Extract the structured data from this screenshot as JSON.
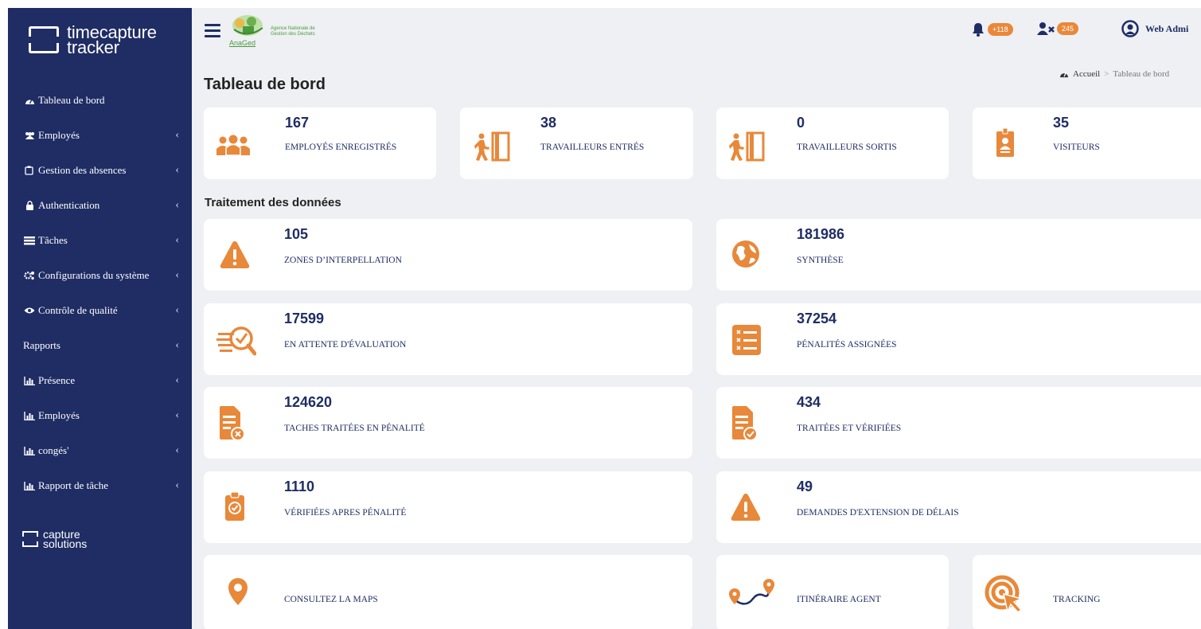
{
  "brand": {
    "line1": "timecapture",
    "line2": "tracker"
  },
  "footer_brand": {
    "line1": "capture",
    "line2": "solutions"
  },
  "sidebar": {
    "items": [
      {
        "label": "Tableau de bord",
        "icon": "tachometer-icon",
        "chevron": false
      },
      {
        "label": "Employés",
        "icon": "users-icon",
        "chevron": true
      },
      {
        "label": "Gestion des absences",
        "icon": "clipboard-icon",
        "chevron": true
      },
      {
        "label": "Authentication",
        "icon": "lock-icon",
        "chevron": true
      },
      {
        "label": "Tâches",
        "icon": "tasks-icon",
        "chevron": true
      },
      {
        "label": "Configurations du système",
        "icon": "gears-icon",
        "chevron": true
      },
      {
        "label": "Contrôle de qualité",
        "icon": "eye-icon",
        "chevron": true
      },
      {
        "label": "Rapports",
        "icon": "",
        "chevron": true
      },
      {
        "label": "Présence",
        "icon": "bar-chart-icon",
        "chevron": true
      },
      {
        "label": "Employés",
        "icon": "bar-chart-icon",
        "chevron": true
      },
      {
        "label": "congés'",
        "icon": "bar-chart-icon",
        "chevron": true
      },
      {
        "label": "Rapport de tâche",
        "icon": "bar-chart-icon",
        "chevron": true
      }
    ]
  },
  "header": {
    "org_name_line1": "Agence Nationale de",
    "org_name_line2": "Gestion des Déchets",
    "org_abbr": "AnaGed",
    "notifications_count": "+118",
    "absent_count": "245",
    "user_name": "Web Admi"
  },
  "breadcrumb": {
    "home": "Accueil",
    "separator": ">",
    "current": "Tableau de bord"
  },
  "page_title": "Tableau de bord",
  "section_title": "Traitement des données",
  "stats": [
    {
      "value": "167",
      "label": "EMPLOYÉS ENREGISTRÉS",
      "icon": "people-group-icon"
    },
    {
      "value": "38",
      "label": "TRAVAILLEURS ENTRÉS",
      "icon": "person-entering-door-icon"
    },
    {
      "value": "0",
      "label": "TRAVAILLEURS SORTIS",
      "icon": "person-leaving-door-icon"
    },
    {
      "value": "35",
      "label": "VISITEURS",
      "icon": "id-badge-icon"
    }
  ],
  "processing": [
    {
      "value": "105",
      "label": "ZONES D’INTERPELLATION",
      "icon": "warning-triangle-icon"
    },
    {
      "value": "181986",
      "label": "SYNTHÈSE",
      "icon": "globe-icon"
    },
    {
      "value": "17599",
      "label": "EN ATTENTE D'ÉVALUATION",
      "icon": "review-magnifier-icon"
    },
    {
      "value": "37254",
      "label": "PÉNALITÉS ASSIGNÉES",
      "icon": "checklist-icon"
    },
    {
      "value": "124620",
      "label": "TACHES TRAITÉES EN PÉNALITÉ",
      "icon": "document-x-icon"
    },
    {
      "value": "434",
      "label": "TRAITÉES ET VÉRIFIÉES",
      "icon": "document-check-icon"
    },
    {
      "value": "1110",
      "label": "VÉRIFIÉES APRES PÉNALITÉ",
      "icon": "clipboard-check-icon"
    },
    {
      "value": "49",
      "label": "DEMANDES D'EXTENSION DE DÉLAIS",
      "icon": "warning-triangle-icon"
    }
  ],
  "links": [
    {
      "label": "CONSULTEZ LA MAPS",
      "icon": "map-pin-icon"
    },
    {
      "label": "ITINÉRAIRE AGENT",
      "icon": "route-icon"
    },
    {
      "label": "TRACKING",
      "icon": "target-cursor-icon"
    }
  ],
  "colors": {
    "sidebar": "#1f2d64",
    "accent": "#e8883a",
    "text_dark": "#1f2d64",
    "background": "#eef0f4"
  }
}
